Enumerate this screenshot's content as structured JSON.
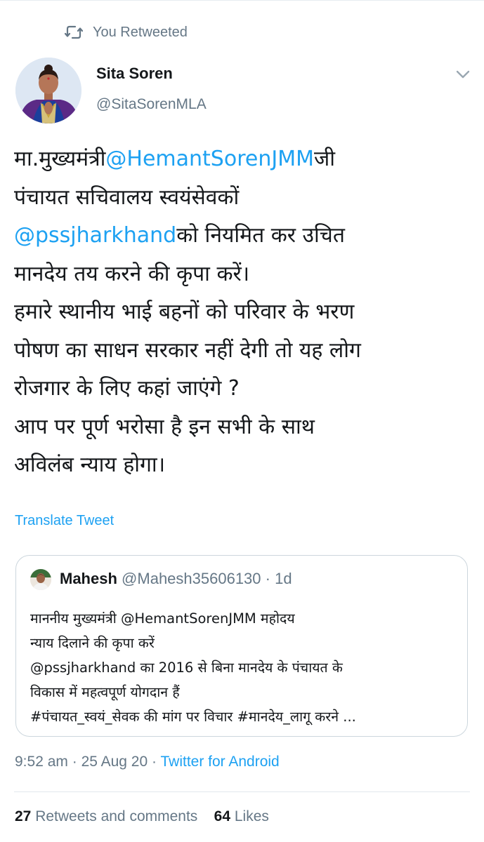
{
  "retweet_banner": {
    "icon": "retweet-icon",
    "label": "You Retweeted"
  },
  "author": {
    "name": "Sita Soren",
    "handle": "@SitaSorenMLA",
    "avatar": "profile-photo"
  },
  "tweet": {
    "lines": [
      {
        "pre": "मा.मुख्यमंत्री",
        "mention": "@HemantSorenJMM",
        "post": "जी"
      },
      {
        "text": "पंचायत सचिवालय स्वयंसेवकों"
      },
      {
        "pre": "",
        "mention": "@pssjharkhand",
        "post": "को नियमित कर उचित"
      },
      {
        "text": "मानदेय तय करने की कृपा करें।"
      },
      {
        "text": "हमारे स्थानीय भाई बहनों को परिवार के भरण"
      },
      {
        "text": "पोषण का साधन सरकार नहीं देगी तो यह लोग"
      },
      {
        "text": "रोजगार के लिए कहां जाएंगे ?"
      },
      {
        "text": "आप पर पूर्ण भरोसा है इन सभी के साथ"
      },
      {
        "text": "अविलंब न्याय होगा।"
      }
    ],
    "translate_label": "Translate Tweet"
  },
  "quoted_tweet": {
    "name": "Mahesh",
    "handle": "@Mahesh35606130",
    "separator": "·",
    "time": "1d",
    "lines": [
      "माननीय मुख्यमंत्री @HemantSorenJMM महोदय",
      "न्याय दिलाने की कृपा करें",
      "@pssjharkhand  का 2016 से बिना मानदेय के पंचायत के",
      "विकास में महत्वपूर्ण योगदान हैं",
      "#पंचायत_स्वयं_सेवक की मांग पर विचार #मानदेय_लागू करने ..."
    ]
  },
  "meta": {
    "time": "9:52 am",
    "date": "25 Aug 20",
    "separator": "·",
    "source": "Twitter for Android"
  },
  "stats": {
    "retweets_count": "27",
    "retweets_label": "Retweets and comments",
    "likes_count": "64",
    "likes_label": "Likes"
  },
  "colors": {
    "accent": "#1da1f2",
    "secondary_text": "#657786",
    "border": "#ccd6dd"
  }
}
